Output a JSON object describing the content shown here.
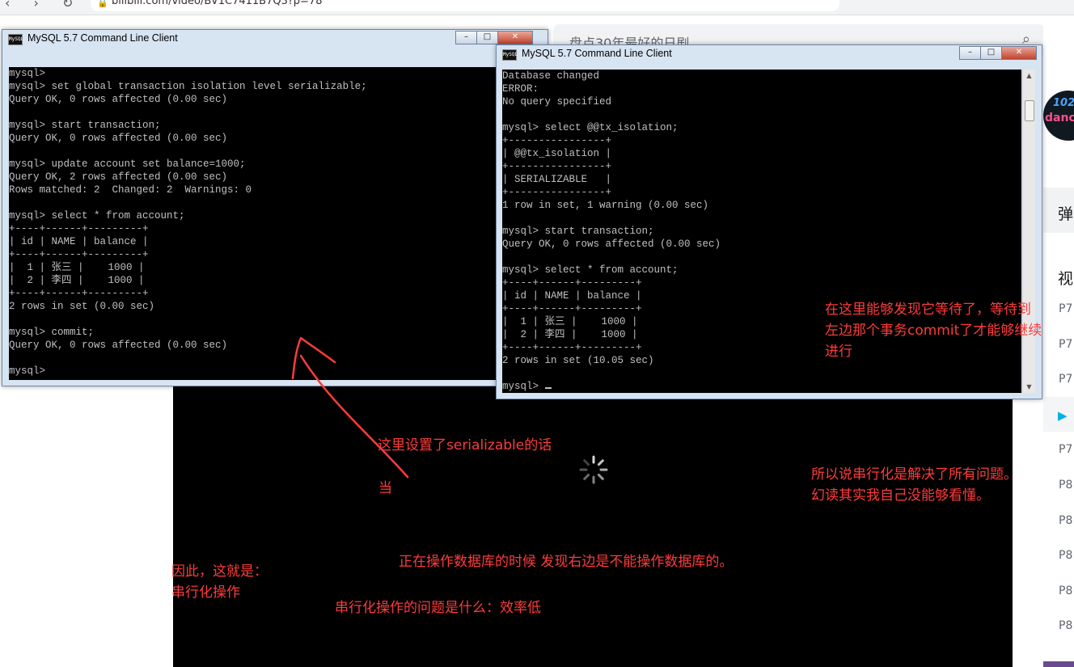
{
  "browser": {
    "nav_glyphs": "‹ › ↻",
    "url": "bilibili.com/video/BV1C7411B7Q3?p=78",
    "search_placeholder": "盘点30年最好的日剧"
  },
  "left_window": {
    "title": "MySQL 5.7 Command Line Client",
    "icon_label": "MySQL",
    "buttons": {
      "minimize": "–",
      "maximize": "□",
      "close": "✕"
    },
    "console_lines": [
      "mysql>",
      "mysql> set global transaction isolation level serializable;",
      "Query OK, 0 rows affected (0.00 sec)",
      "",
      "mysql> start transaction;",
      "Query OK, 0 rows affected (0.00 sec)",
      "",
      "mysql> update account set balance=1000;",
      "Query OK, 2 rows affected (0.00 sec)",
      "Rows matched: 2  Changed: 2  Warnings: 0",
      "",
      "mysql> select * from account;",
      "+----+------+---------+",
      "| id | NAME | balance |",
      "+----+------+---------+",
      "|  1 | 张三 |    1000 |",
      "|  2 | 李四 |    1000 |",
      "+----+------+---------+",
      "2 rows in set (0.00 sec)",
      "",
      "mysql> commit;",
      "Query OK, 0 rows affected (0.00 sec)",
      "",
      "mysql>"
    ]
  },
  "right_window": {
    "title": "MySQL 5.7 Command Line Client",
    "icon_label": "MySQL",
    "buttons": {
      "minimize": "–",
      "maximize": "□",
      "close": "✕"
    },
    "console_lines": [
      "Database changed",
      "ERROR:",
      "No query specified",
      "",
      "mysql> select @@tx_isolation;",
      "+----------------+",
      "| @@tx_isolation |",
      "+----------------+",
      "| SERIALIZABLE   |",
      "+----------------+",
      "1 row in set, 1 warning (0.00 sec)",
      "",
      "mysql> start transaction;",
      "Query OK, 0 rows affected (0.00 sec)",
      "",
      "mysql> select * from account;",
      "+----+------+---------+",
      "| id | NAME | balance |",
      "+----+------+---------+",
      "|  1 | 张三 |    1000 |",
      "|  2 | 李四 |    1000 |",
      "+----+------+---------+",
      "2 rows in set (10.05 sec)",
      "",
      "mysql> "
    ],
    "scroll_up": "▲",
    "scroll_down": "▼"
  },
  "annotations": {
    "wait_note": "在这里能够发现它等待了，等待到\n左边那个事务commit了才能够继续\n进行",
    "serializable_note": "这里设置了serializable的话",
    "dang": "当",
    "solved_note": "所以说串行化是解决了所有问题。\n幻读其实我自己没能够看懂。",
    "operating_note": "正在操作数据库的时候 发现右边是不能操作数据库的。",
    "therefore_note": "因此，这就是：\n串行化操作",
    "problem_note": "串行化操作的问题是什么：效率低"
  },
  "sidebar": {
    "avatar_line1": "102",
    "avatar_line2": "danci",
    "danmu_label": "弹",
    "view_label": "视",
    "items": [
      "P7",
      "P7",
      "P7",
      "",
      "P7",
      "P8",
      "P8",
      "P8",
      "P8",
      "P8"
    ],
    "active_icon": "▶"
  },
  "colors": {
    "annotation": "#ff3b3b",
    "console_bg": "#000000",
    "console_text": "#c0c0c0",
    "window_frame": "#d7e4f2",
    "accent": "#00aeec"
  }
}
